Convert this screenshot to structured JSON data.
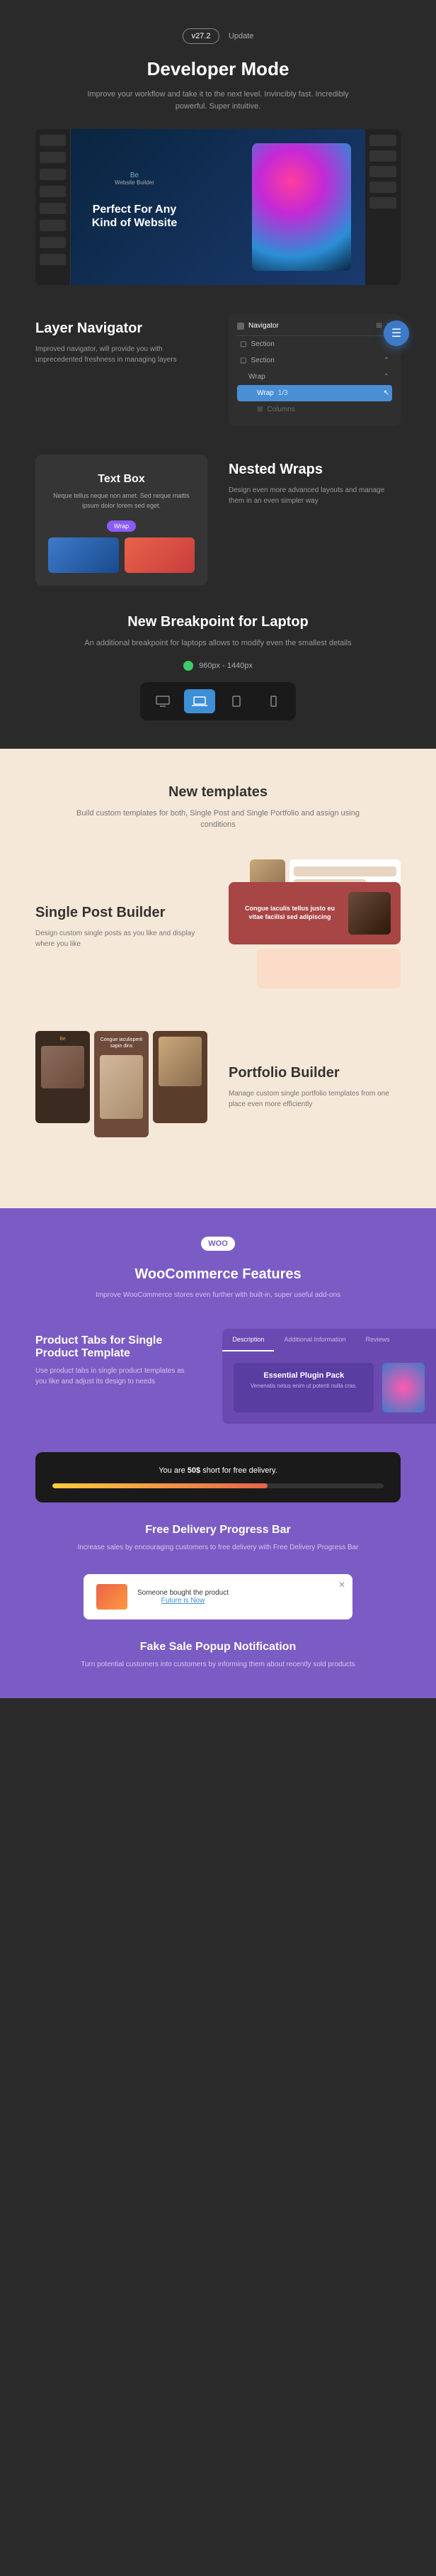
{
  "header": {
    "version": "v27.2",
    "badge_label": "Update",
    "title": "Developer Mode",
    "subtitle": "Improve your workflow and take it to the next level. Invincibly fast. Incredibly powerful. Super intuitive."
  },
  "screenshot": {
    "brand": "Be",
    "tag": "Website Builder",
    "headline": "Perfect For Any Kind of Website"
  },
  "navigator": {
    "title": "Layer Navigator",
    "desc": "Improved navigator, will provide you with unprecedented freshness in managing layers",
    "panel_title": "Navigator",
    "items": [
      "Section",
      "Section",
      "Wrap",
      "Wrap",
      "Columns"
    ],
    "highlighted_index": 3,
    "highlighted_suffix": "1/3"
  },
  "textbox": {
    "title": "Text Box",
    "desc": "Neque tellus neque non amet. Sed neque mattis ipsum dolor lorem sed eget.",
    "wrap_label": "Wrap"
  },
  "nested": {
    "title": "Nested Wraps",
    "desc": "Design even more advanced layouts and manage them in an even simpler way"
  },
  "breakpoint": {
    "title": "New Breakpoint for Laptop",
    "subtitle": "An additional breakpoint for laptops allows to modify even the smallest details",
    "range": "960px - 1440px"
  },
  "templates": {
    "title": "New templates",
    "subtitle": "Build custom templates for both, Single Post and Single Portfolio and assign using conditions"
  },
  "single_post": {
    "title": "Single Post Builder",
    "desc": "Design custom single posts as you like and display where you like",
    "mockup_text": "Congue iaculis tellus justo eu vitae facilisi sed adipiscing"
  },
  "portfolio": {
    "title": "Portfolio Builder",
    "desc": "Manage custom single portfolio templates from one place even more efficiently",
    "brand": "Be",
    "item_text": "Congue iaculisperit sapin dins"
  },
  "woo": {
    "logo": "WOO",
    "title": "WooCommerce Features",
    "subtitle": "Improve WooCommerce stores even further with built-in, super useful add-ons"
  },
  "product_tabs": {
    "title": "Product Tabs for Single Product Template",
    "desc": "Use product tabs in single product templates as you like and adjust its design to needs",
    "tabs": [
      "Description",
      "Additional Information",
      "Reviews"
    ],
    "plugin_title": "Essential Plugin Pack",
    "plugin_desc": "Venenatis netus enim ut potenti nulla cras."
  },
  "progress": {
    "text_before": "You are ",
    "amount": "50$",
    "text_after": " short for free delivery.",
    "title": "Free Delivery Progress Bar",
    "desc": "Increase sales by encouraging customers to free delivery with Free Delivery Progress Bar"
  },
  "popup": {
    "text": "Someone bought the product",
    "link": "Future is Now",
    "title": "Fake Sale Popup Notification",
    "desc": "Turn potential customers into customers by informing them about recently sold products"
  }
}
